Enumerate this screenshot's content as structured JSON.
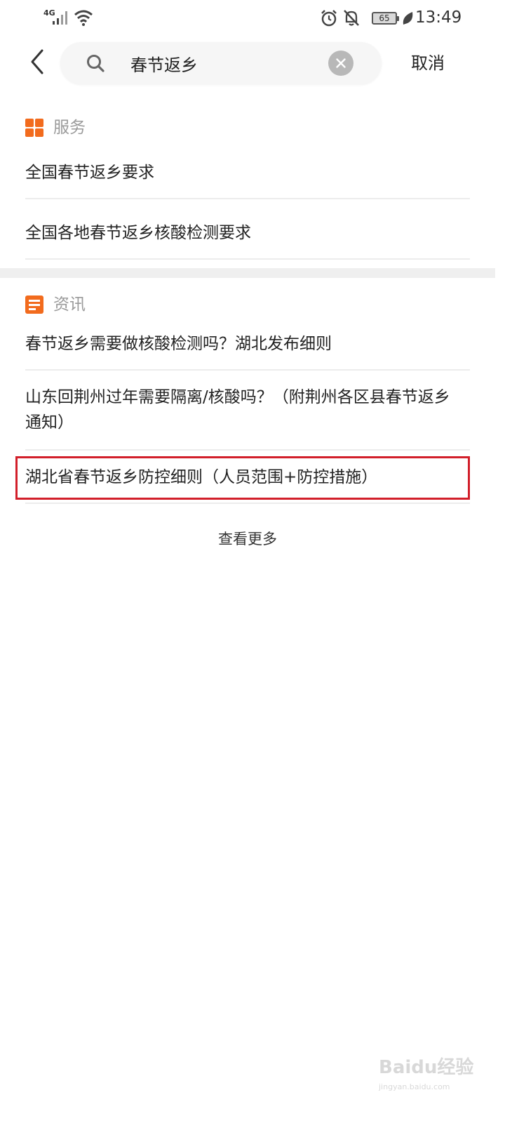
{
  "status_bar": {
    "network": "4G",
    "battery": "65",
    "time": "13:49"
  },
  "search": {
    "query": "春节返乡",
    "cancel_label": "取消"
  },
  "sections": {
    "services": {
      "title": "服务",
      "items": [
        "全国春节返乡要求",
        "全国各地春节返乡核酸检测要求"
      ]
    },
    "news": {
      "title": "资讯",
      "items": [
        "春节返乡需要做核酸检测吗？湖北发布细则",
        "山东回荆州过年需要隔离/核酸吗？（附荆州各区县春节返乡通知）",
        "湖北省春节返乡防控细则（人员范围+防控措施）"
      ]
    }
  },
  "more_label": "查看更多",
  "watermark": {
    "text": "Baidu经验",
    "url": "jingyan.baidu.com"
  },
  "colors": {
    "accent_orange": "#f26b1d",
    "highlight_red": "#d21f2a",
    "section_title_gray": "#9a9a9a"
  },
  "icons": [
    "signal-icon",
    "wifi-icon",
    "alarm-icon",
    "bell-off-icon",
    "battery-icon",
    "leaf-icon",
    "back-icon",
    "search-icon",
    "clear-icon",
    "grid-icon",
    "news-icon"
  ]
}
